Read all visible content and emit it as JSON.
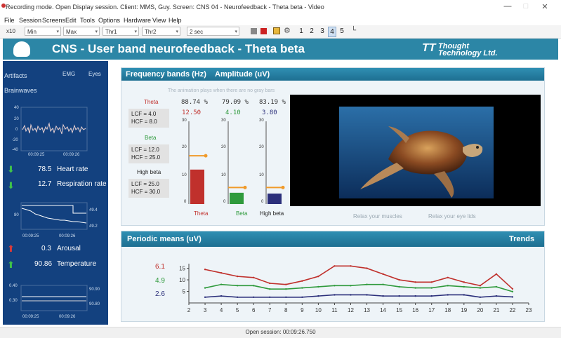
{
  "window": {
    "title": "Recording mode. Open Display session. Client: MMS, Guy. Screen: CNS 04 - Neurofeedback - Theta beta - Video"
  },
  "menu": [
    "File",
    "Session",
    "Screens",
    "Edit",
    "Tools",
    "Options",
    "Hardware",
    "View",
    "Help"
  ],
  "toolbar": {
    "zoom": "x10",
    "min_label": "Min",
    "max_label": "Max",
    "thr1_label": "Thr1",
    "thr2_label": "Thr2",
    "time_label": "2 sec",
    "pages": [
      "1",
      "2",
      "3",
      "4",
      "5"
    ],
    "active_page": "4"
  },
  "header": {
    "title": "CNS - User band neurofeedback - Theta beta",
    "logo_line1": "Thought",
    "logo_line2": "Technology Ltd."
  },
  "left": {
    "artifacts": "Artifacts",
    "emg": "EMG",
    "eyes": "Eyes",
    "brainwaves": "Brainwaves",
    "bw_y": [
      "40",
      "20",
      "0",
      "-20",
      "-40"
    ],
    "bw_t1": "00:09:25",
    "bw_t2": "00:09:26",
    "heart_value": "78.5",
    "heart_label": "Heart rate",
    "resp_value": "12.7",
    "resp_label": "Respiration rate",
    "g2_y_left": "80",
    "g2_y_right_top": "49.4",
    "g2_y_right_bottom": "49.2",
    "g2_t1": "00:09:25",
    "g2_t2": "00:09:26",
    "arousal_value": "0.3",
    "arousal_label": "Arousal",
    "temp_value": "90.86",
    "temp_label": "Temperature",
    "g3_y_left_top": "0.40",
    "g3_y_left_bottom": "0.30",
    "g3_y_right_top": "90.90",
    "g3_y_right_bottom": "90.80",
    "g3_t1": "00:09:25",
    "g3_t2": "00:09:26"
  },
  "bands": {
    "header_left": "Frequency bands (Hz)",
    "header_right": "Amplitude (uV)",
    "hint": "The animation plays when there are no gray bars",
    "theta_name": "Theta",
    "theta_lcf": "LCF = 4.0",
    "theta_hcf": "HCF = 8.0",
    "beta_name": "Beta",
    "beta_lcf": "LCF = 12.0",
    "beta_hcf": "HCF = 25.0",
    "highbeta_name": "High beta",
    "highbeta_lcf": "LCF = 25.0",
    "highbeta_hcf": "HCF = 30.0",
    "theta_pct": "88.74 %",
    "beta_pct": "79.09 %",
    "highbeta_pct": "83.19 %",
    "theta_cur": "12.50",
    "beta_cur": "4.10",
    "highbeta_cur": "3.80",
    "scale_ticks": [
      "30",
      "20",
      "10",
      "0"
    ],
    "bar_theta_label": "Theta",
    "bar_beta_label": "Beta",
    "bar_highbeta_label": "High beta",
    "relax_muscles": "Relax your muscles",
    "relax_eyelids": "Relax your eye lids"
  },
  "bar_levels": {
    "theta": {
      "value": 12.5,
      "threshold": 17.5
    },
    "beta": {
      "value": 4.1,
      "threshold": 6.0
    },
    "highbeta": {
      "value": 3.8,
      "threshold": 6.0
    },
    "max": 30
  },
  "colors": {
    "theta": "#c0302c",
    "beta": "#2f9a3c",
    "highbeta": "#2b2f7a",
    "threshold": "#f09a2a",
    "header": "#2c86a6",
    "left_panel": "#13417f"
  },
  "periodic": {
    "header_left": "Periodic means (uV)",
    "header_right": "Trends",
    "theta_latest": "6.1",
    "beta_latest": "4.9",
    "highbeta_latest": "2.6"
  },
  "chart_data": {
    "type": "line",
    "title": "Periodic means (uV)",
    "x": [
      3,
      4,
      5,
      6,
      7,
      8,
      9,
      10,
      11,
      12,
      13,
      14,
      15,
      16,
      17,
      18,
      19,
      20,
      21,
      22
    ],
    "xticks": [
      2,
      3,
      4,
      5,
      6,
      7,
      8,
      9,
      10,
      11,
      12,
      13,
      14,
      15,
      16,
      17,
      18,
      19,
      20,
      21,
      22,
      23
    ],
    "yticks": [
      5,
      10,
      15
    ],
    "xlim": [
      2,
      23
    ],
    "ylim": [
      0,
      17
    ],
    "series": [
      {
        "key": "theta",
        "color": "#c0302c",
        "values": [
          14.5,
          13.0,
          11.5,
          11.0,
          8.5,
          8.0,
          9.5,
          11.5,
          16.0,
          16.0,
          15.0,
          12.5,
          10.0,
          9.0,
          9.0,
          11.0,
          9.0,
          7.5,
          12.5,
          6.1
        ]
      },
      {
        "key": "beta",
        "color": "#2f9a3c",
        "values": [
          6.5,
          8.0,
          7.5,
          7.5,
          6.0,
          6.0,
          6.5,
          7.0,
          7.5,
          7.5,
          8.0,
          8.0,
          7.0,
          6.5,
          6.5,
          7.5,
          7.0,
          6.5,
          7.0,
          4.9
        ]
      },
      {
        "key": "highbeta",
        "color": "#2b2f7a",
        "values": [
          2.5,
          3.0,
          2.5,
          2.5,
          2.5,
          2.5,
          2.5,
          3.0,
          3.5,
          3.5,
          3.5,
          3.0,
          3.0,
          3.0,
          3.0,
          3.5,
          3.5,
          2.5,
          3.0,
          2.6
        ]
      }
    ]
  },
  "status": {
    "text": "Open session: 00:09:26.750"
  }
}
